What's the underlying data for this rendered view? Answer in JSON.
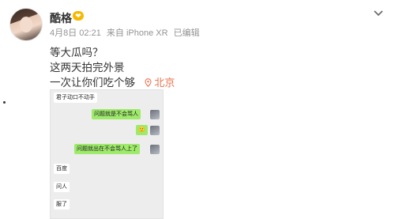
{
  "post": {
    "username": "酷格",
    "badge_icon": "vip-badge-icon",
    "date": "4月8日 02:21",
    "source": "来自 iPhone XR",
    "edited": "已编辑",
    "lines": [
      "等大瓜吗？",
      "这两天拍完外景",
      "一次让你们吃个够"
    ],
    "location": "北京",
    "location_color": "#eb7350"
  },
  "chat": {
    "messages": [
      {
        "side": "left",
        "text": "君子动口不动手"
      },
      {
        "side": "right",
        "text": "问题就是不会骂人"
      },
      {
        "side": "right",
        "text": "🙂"
      },
      {
        "side": "right",
        "text": "问题就出在不会骂人上了"
      },
      {
        "side": "left",
        "text": "百度"
      },
      {
        "side": "left",
        "text": "问人"
      },
      {
        "side": "left",
        "text": "服了"
      }
    ],
    "bubble_color_self": "#9eea6a"
  }
}
